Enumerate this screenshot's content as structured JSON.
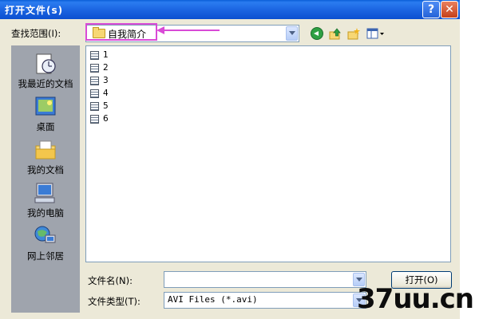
{
  "window": {
    "title": "打开文件(s)",
    "help_glyph": "?",
    "close_glyph": "✕"
  },
  "toolbar": {
    "look_in_label": "查找范围(I):",
    "look_in_value": "自我简介"
  },
  "places": [
    {
      "label": "我最近的文档",
      "icon": "recent-documents-icon"
    },
    {
      "label": "桌面",
      "icon": "desktop-icon"
    },
    {
      "label": "我的文档",
      "icon": "my-documents-icon"
    },
    {
      "label": "我的电脑",
      "icon": "my-computer-icon"
    },
    {
      "label": "网上邻居",
      "icon": "network-places-icon"
    }
  ],
  "files": [
    "1",
    "2",
    "3",
    "4",
    "5",
    "6"
  ],
  "footer": {
    "filename_label": "文件名(N):",
    "filename_value": "",
    "filetype_label": "文件类型(T):",
    "filetype_value": "AVI Files (*.avi)",
    "open_button": "打开(O)"
  },
  "watermark": "37uu.cn",
  "colors": {
    "title_bar": "#1a63e0",
    "highlight": "#d94ad6",
    "dialog_bg": "#ece9d8"
  }
}
